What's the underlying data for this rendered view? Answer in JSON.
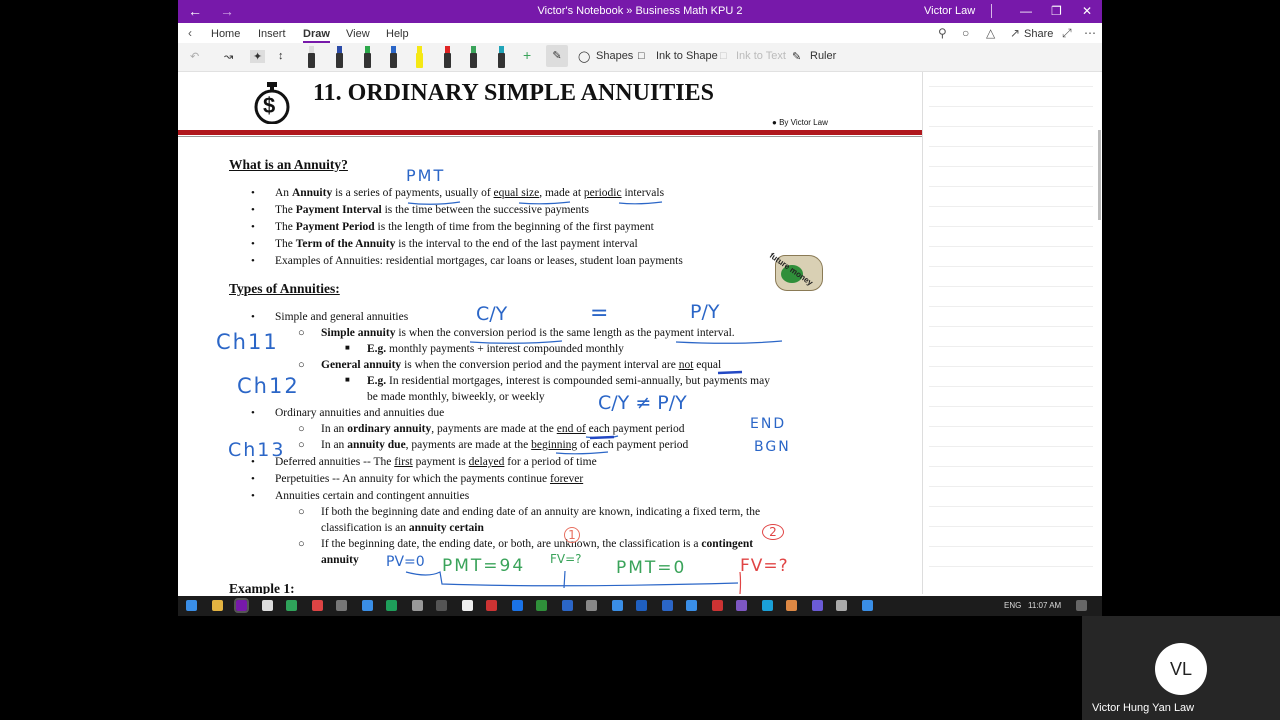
{
  "window": {
    "title": "Victor's Notebook » Business Math KPU 2",
    "user": "Victor Law",
    "back_glyph": "←",
    "forward_glyph": "→"
  },
  "menu": {
    "tabs": [
      "Home",
      "Insert",
      "Draw",
      "View",
      "Help"
    ],
    "active": "Draw",
    "share": "Share"
  },
  "toolbar": {
    "shapes": "Shapes",
    "ink_to_shape": "Ink to Shape",
    "ink_to_text": "Ink to Text",
    "ruler": "Ruler",
    "add_pen": "+"
  },
  "page": {
    "title": "11. ORDINARY SIMPLE ANNUITIES",
    "byline": "By Victor Law",
    "logo_symbol": "$",
    "sticker_text": "future money",
    "h1": "What is an Annuity?",
    "h2": "Types of Annuities:",
    "example": "Example 1:",
    "def": {
      "l1a": "An ",
      "l1b": "Annuity",
      "l1c": " is a series of ",
      "l1d": "payments",
      "l1e": ", usually of ",
      "l1f": "equal size",
      "l1g": ", made at ",
      "l1h": "periodic",
      "l1i": " intervals",
      "l2a": "The ",
      "l2b": "Payment Interval",
      "l2c": " is the time between the successive payments",
      "l3a": "The ",
      "l3b": "Payment Period",
      "l3c": " is the length of time from the beginning of the first payment",
      "l4a": "The ",
      "l4b": "Term of the Annuity",
      "l4c": " is the interval to the end of the last payment interval",
      "l5": "Examples of Annuities: residential mortgages, car loans or leases, student loan payments"
    },
    "types": {
      "t1": "Simple and general annuities",
      "t1a1": "Simple annuity",
      "t1a2": " is when the ",
      "t1a3": "conversion period",
      "t1a4": " is the same length as ",
      "t1a5": "the payment interval",
      "t1a6": ".",
      "t1b1": "E.g.",
      "t1b2": " monthly payments + interest compounded monthly",
      "t1c1": "General annuity",
      "t1c2": " is when the conversion period and the payment interval are ",
      "t1c3": "not",
      "t1c4": " equal",
      "t1d1": "E.g.",
      "t1d2": " In residential mortgages, interest is compounded semi-annually, but payments may",
      "t1d3": "be made monthly, biweekly, or weekly",
      "t2": "Ordinary annuities and annuities due",
      "t2a1": "In an ",
      "t2a2": "ordinary annuity",
      "t2a3": ", payments are made at the ",
      "t2a4": "end of",
      "t2a5": " each payment period",
      "t2b1": "In an ",
      "t2b2": "annuity due",
      "t2b3": ", payments are made at the ",
      "t2b4": "beginning",
      "t2b5": " of each payment period",
      "t3a": "Deferred annuities -- The ",
      "t3b": "first",
      "t3c": " payment is ",
      "t3d": "delayed",
      "t3e": " for a period of time",
      "t4a": "Perpetuities -- An annuity for which the payments continue ",
      "t4b": "forever",
      "t5": "Annuities certain and contingent annuities",
      "t5a1": "If both the beginning date and ending date of an annuity are known, indicating a fixed term, the",
      "t5a2": "classification is an ",
      "t5a3": "annuity certain",
      "t5b1": "If the beginning date, the ending date, or both, are unknown, the classification is a ",
      "t5b2": "contingent",
      "t5b3": "annuity"
    },
    "ink": {
      "pmt": "PMT",
      "cy": "C/Y",
      "eq": "=",
      "py": "P/Y",
      "ch11": "Ch11",
      "ch12": "Ch12",
      "ch13": "Ch13",
      "neq": "C/Y ≠ P/Y",
      "end": "END",
      "bgn": "BGN",
      "c1": "1",
      "c2": "2",
      "pv0": "PV=0",
      "pmt94": "PMT=94",
      "fvq": "FV=?",
      "pmt0": "PMT=0",
      "fvq2": "FV=?"
    }
  },
  "taskbar": {
    "lang": "ENG",
    "clock": "11:07 AM"
  },
  "video": {
    "initials": "VL",
    "name": "Victor Hung Yan Law"
  },
  "colors": {
    "accent": "#7719aa",
    "red_rule": "#b0171d",
    "ink_blue": "#2b66c7",
    "ink_green": "#3aa35a",
    "ink_red": "#e04444"
  }
}
